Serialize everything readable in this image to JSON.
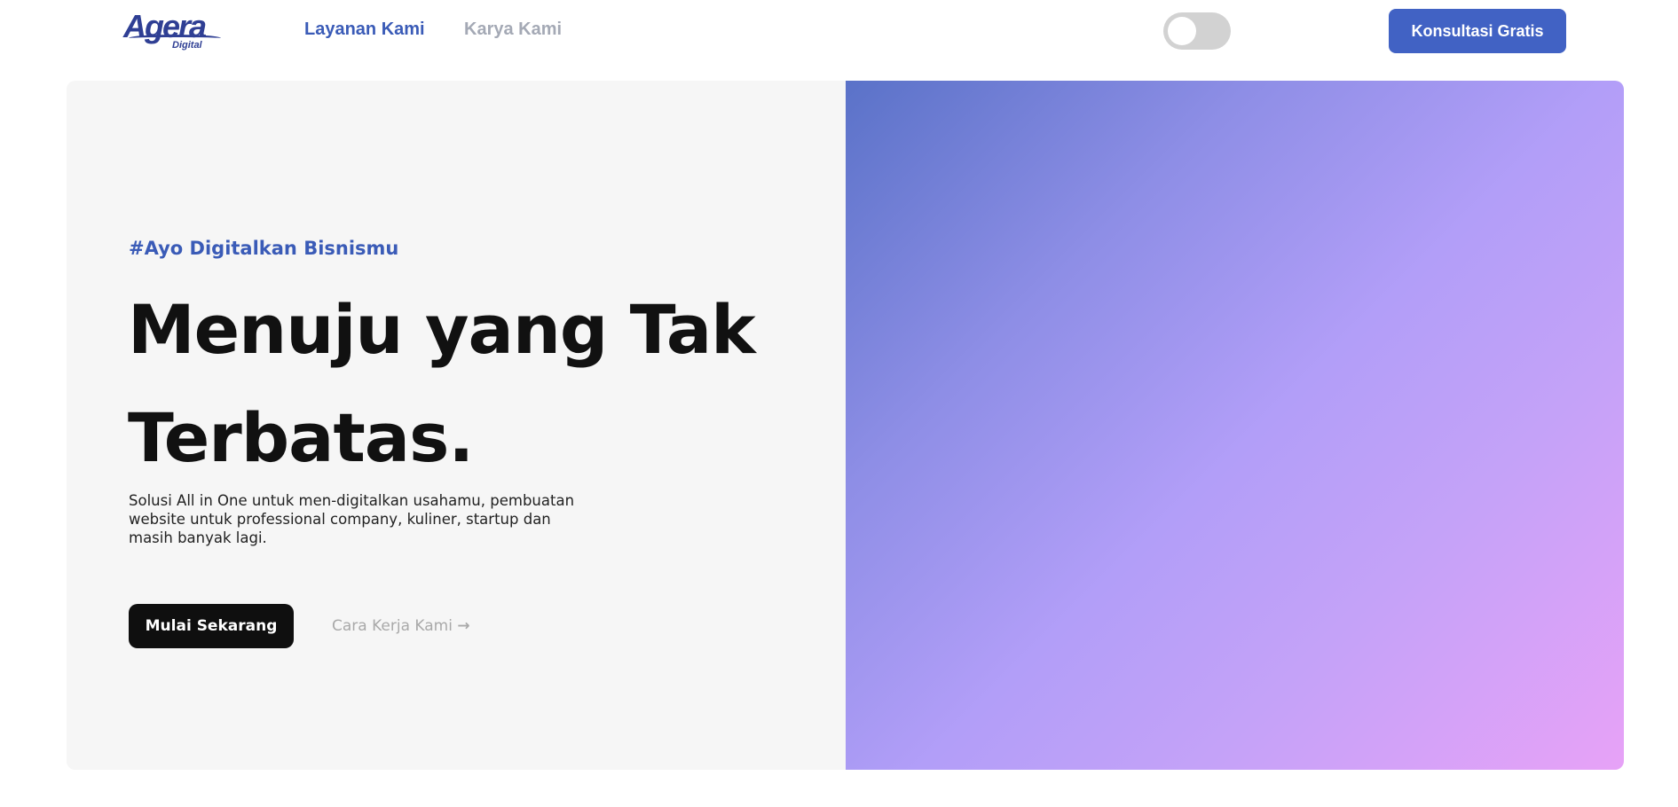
{
  "header": {
    "logo": {
      "main": "Agera",
      "sub": "Digital"
    },
    "nav": [
      {
        "label": "Layanan Kami",
        "active": true
      },
      {
        "label": "Karya Kami",
        "active": false
      }
    ],
    "theme_toggle": {
      "state": "off"
    },
    "cta_label": "Konsultasi Gratis"
  },
  "hero": {
    "tagline": "#Ayo Digitalkan Bisnismu",
    "headline_line1": "Menuju yang Tak",
    "headline_line2": "Terbatas.",
    "description": "Solusi All in One untuk men-digitalkan usahamu, pembuatan website untuk professional company, kuliner, startup dan masih banyak lagi.",
    "primary_button": "Mulai Sekarang",
    "secondary_link": "Cara Kerja Kami",
    "arrow_icon": "→",
    "gradient_colors": [
      "#5a72c8",
      "#b29ef8",
      "#e7a2f7"
    ]
  },
  "colors": {
    "accent": "#3a5bb7",
    "cta": "#4162c4",
    "dark": "#0f0f0f"
  }
}
